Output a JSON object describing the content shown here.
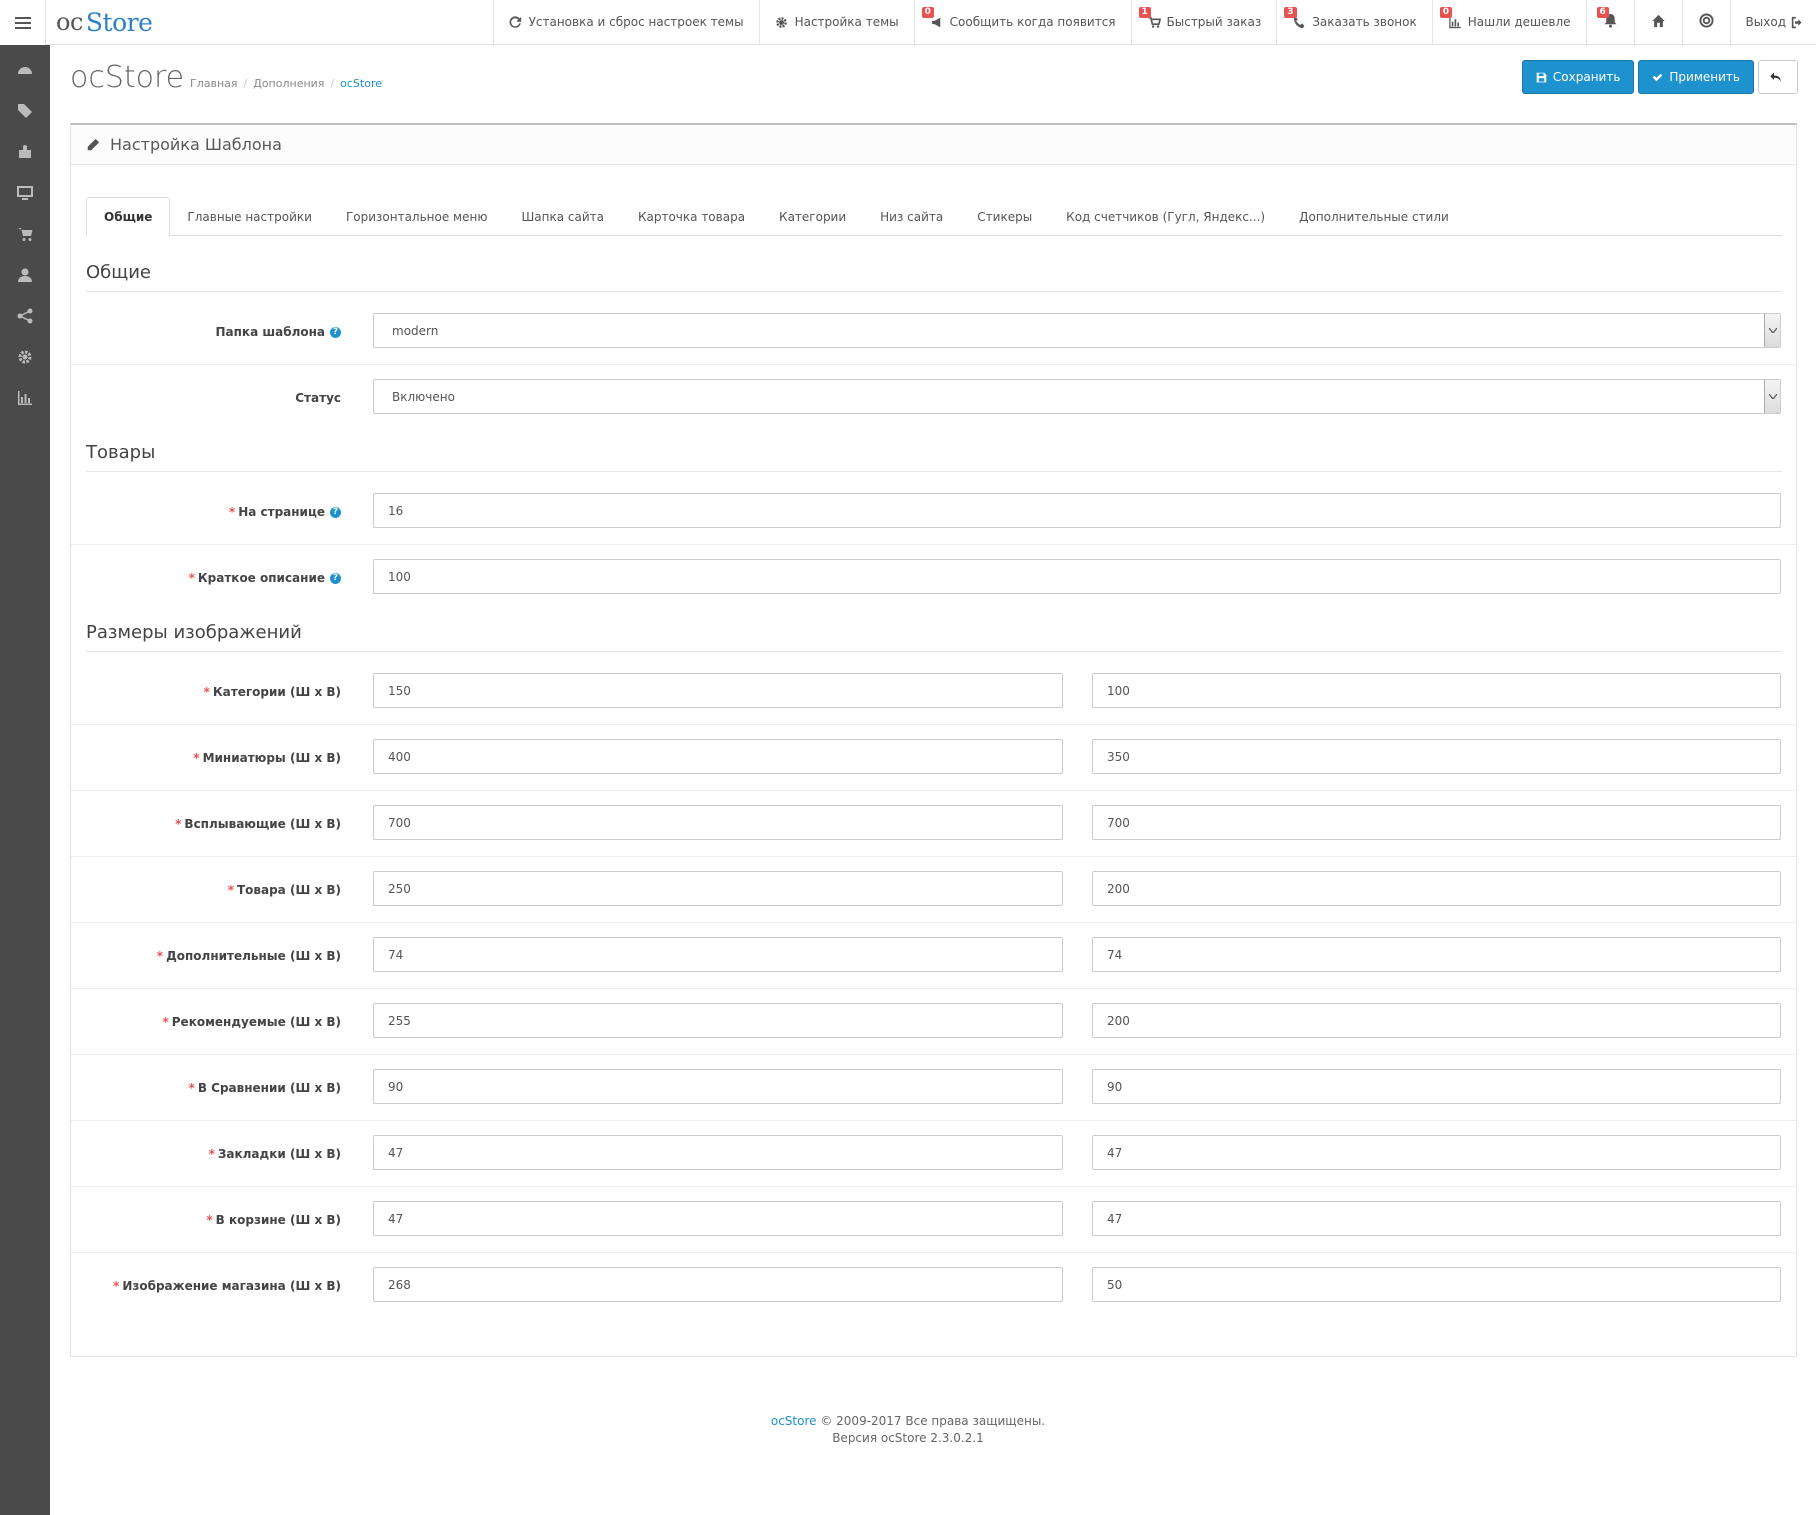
{
  "app": {
    "logo_prefix": "oc",
    "logo_name": "Store"
  },
  "topnav": {
    "items": [
      {
        "label": "Установка и сброс настроек темы",
        "icon": "refresh-icon",
        "badge": ""
      },
      {
        "label": "Настройка темы",
        "icon": "gear-icon",
        "badge": ""
      },
      {
        "label": "Сообщить когда появится",
        "icon": "megaphone-icon",
        "badge": "0"
      },
      {
        "label": "Быстрый заказ",
        "icon": "cart-icon",
        "badge": "1"
      },
      {
        "label": "Заказать звонок",
        "icon": "phone-icon",
        "badge": "3"
      },
      {
        "label": "Нашли дешевле",
        "icon": "bar-chart-icon",
        "badge": "0"
      }
    ],
    "bell_badge": "6",
    "logout_label": "Выход"
  },
  "page": {
    "title": "ocStore",
    "breadcrumb": [
      "Главная",
      "Дополнения",
      "ocStore"
    ],
    "save_label": "Сохранить",
    "apply_label": "Применить"
  },
  "panel": {
    "heading": "Настройка Шаблона"
  },
  "tabs": [
    "Общие",
    "Главные настройки",
    "Горизонтальное меню",
    "Шапка сайта",
    "Карточка товара",
    "Категории",
    "Низ сайта",
    "Стикеры",
    "Код счетчиков (Гугл, Яндекс...)",
    "Дополнительные стили"
  ],
  "sections": {
    "general": "Общие",
    "products": "Товары",
    "images": "Размеры изображений"
  },
  "general": {
    "folder_label": "Папка шаблона",
    "folder_value": "modern",
    "status_label": "Статус",
    "status_value": "Включено"
  },
  "products": {
    "per_page_label": "На странице",
    "per_page_value": "16",
    "short_desc_label": "Краткое описание",
    "short_desc_value": "100"
  },
  "images": [
    {
      "label": "Категории (Ш х В)",
      "w": "150",
      "h": "100"
    },
    {
      "label": "Миниатюры (Ш х В)",
      "w": "400",
      "h": "350"
    },
    {
      "label": "Всплывающие (Ш х В)",
      "w": "700",
      "h": "700"
    },
    {
      "label": "Товара (Ш х В)",
      "w": "250",
      "h": "200"
    },
    {
      "label": "Дополнительные (Ш х В)",
      "w": "74",
      "h": "74"
    },
    {
      "label": "Рекомендуемые (Ш х В)",
      "w": "255",
      "h": "200"
    },
    {
      "label": "В Сравнении (Ш х В)",
      "w": "90",
      "h": "90"
    },
    {
      "label": "Закладки (Ш х В)",
      "w": "47",
      "h": "47"
    },
    {
      "label": "В корзине (Ш х В)",
      "w": "47",
      "h": "47"
    },
    {
      "label": "Изображение магазина (Ш х В)",
      "w": "268",
      "h": "50"
    }
  ],
  "footer": {
    "link": "ocStore",
    "copyright": "© 2009-2017 Все права защищены.",
    "version": "Версия ocStore 2.3.0.2.1"
  }
}
